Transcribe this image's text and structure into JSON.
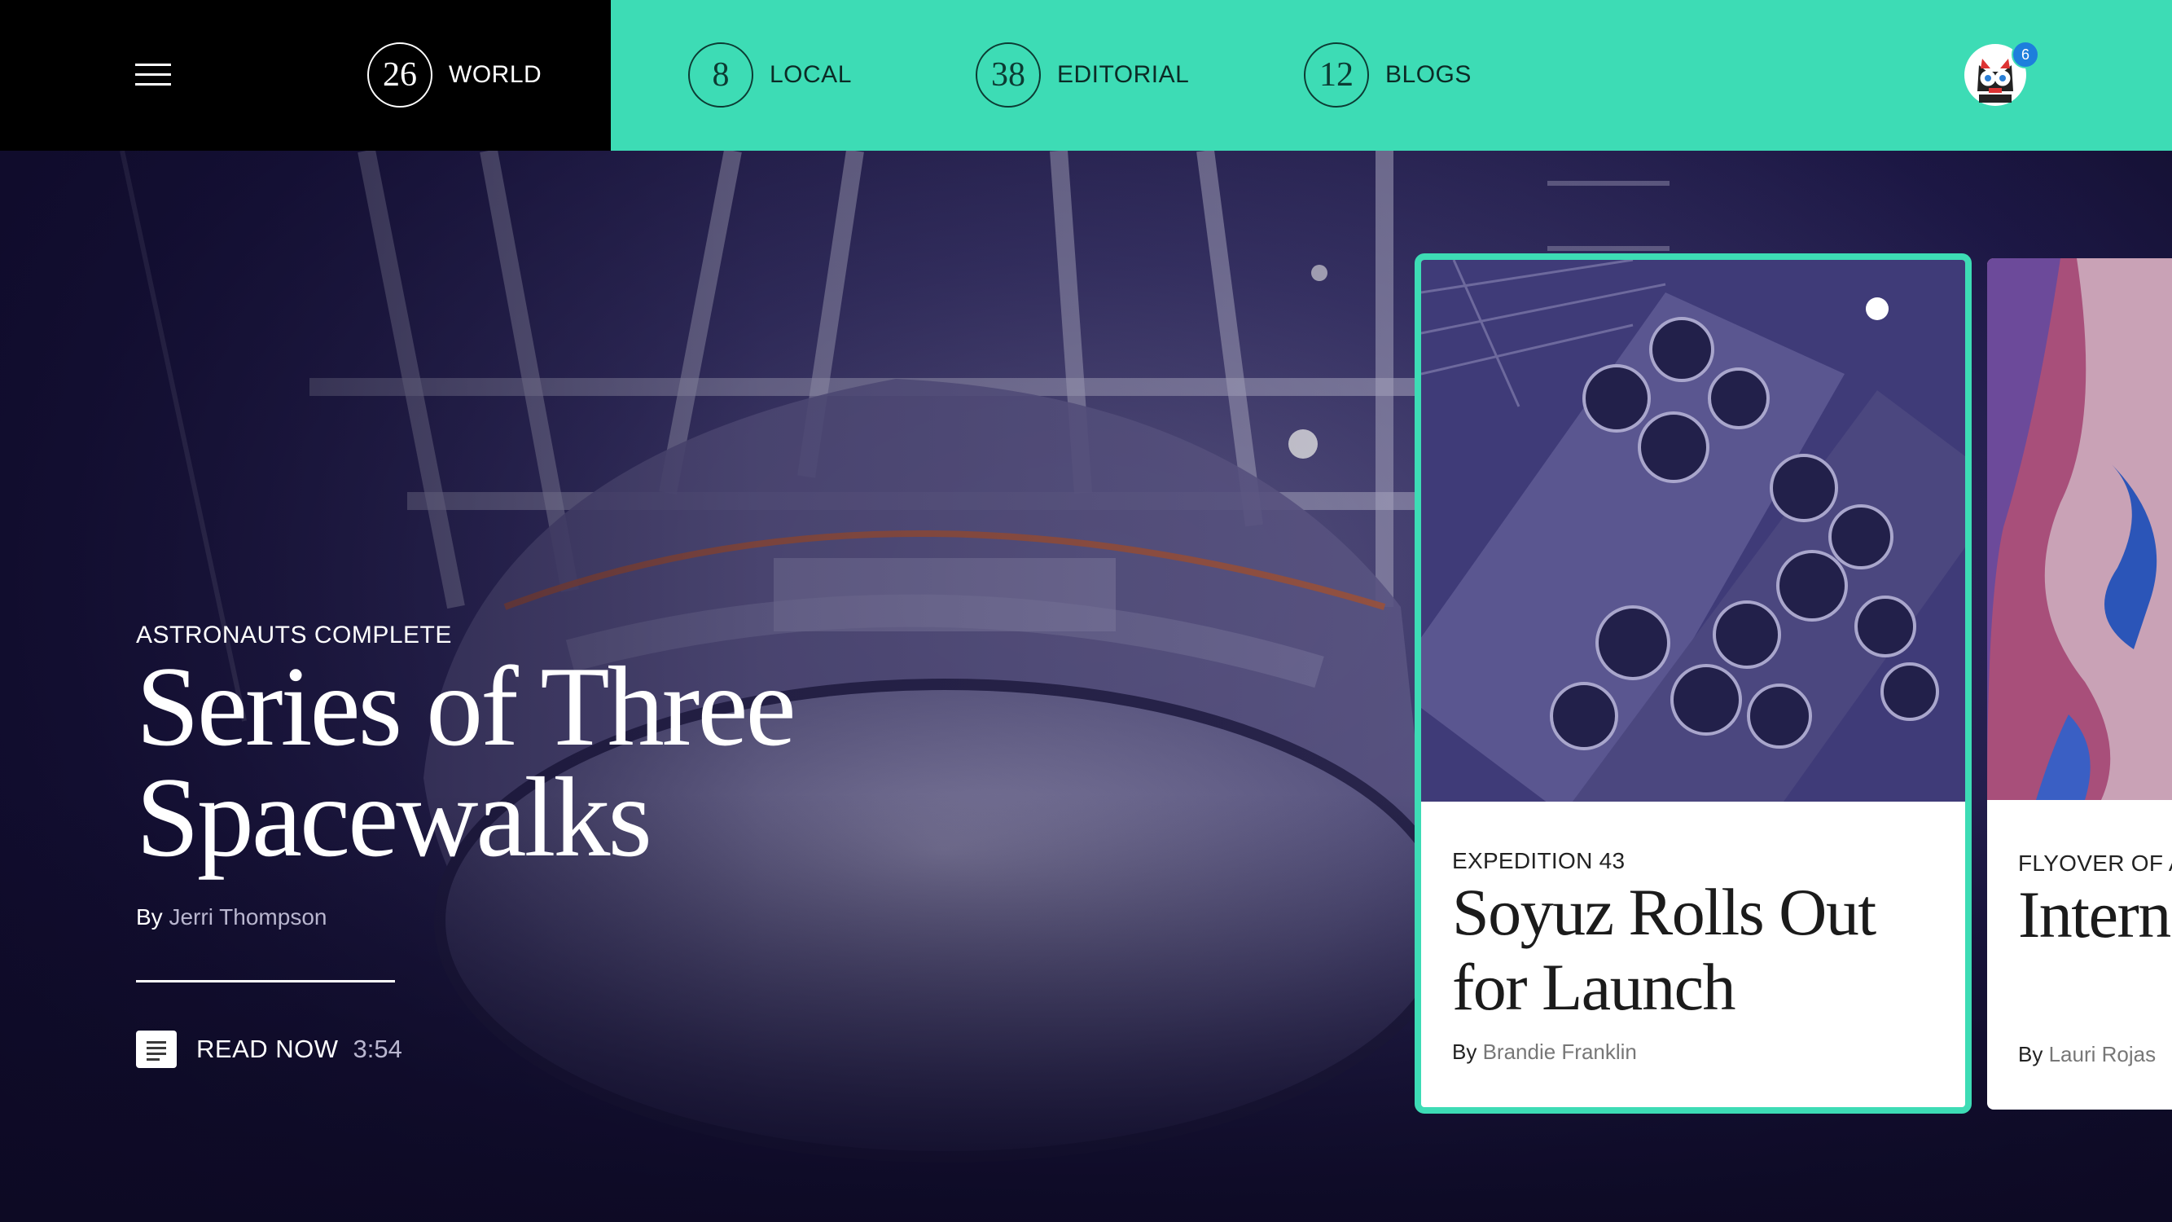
{
  "nav": {
    "menu_icon": "hamburger-menu-icon",
    "items": [
      {
        "count": "26",
        "label": "WORLD"
      },
      {
        "count": "8",
        "label": "LOCAL"
      },
      {
        "count": "38",
        "label": "EDITORIAL"
      },
      {
        "count": "12",
        "label": "BLOGS"
      }
    ],
    "avatar_icon": "cat-avatar-icon",
    "notification_count": "6",
    "colors": {
      "accent": "#3ddcb5",
      "dark": "#000000",
      "badge": "#1d7fdc"
    }
  },
  "hero": {
    "kicker": "ASTRONAUTS COMPLETE",
    "headline": "Series of Three Spacewalks",
    "byline_prefix": "By",
    "author": "Jerri Thompson",
    "read_icon": "article-icon",
    "read_label": "READ NOW",
    "read_time": "3:54"
  },
  "cards": [
    {
      "kicker": "EXPEDITION 43",
      "title": "Soyuz Rolls Out for Launch",
      "byline_prefix": "By",
      "author": "Brandie Franklin"
    },
    {
      "kicker": "FLYOVER OF A",
      "title": "Intern Space",
      "byline_prefix": "By",
      "author": "Lauri Rojas"
    }
  ]
}
